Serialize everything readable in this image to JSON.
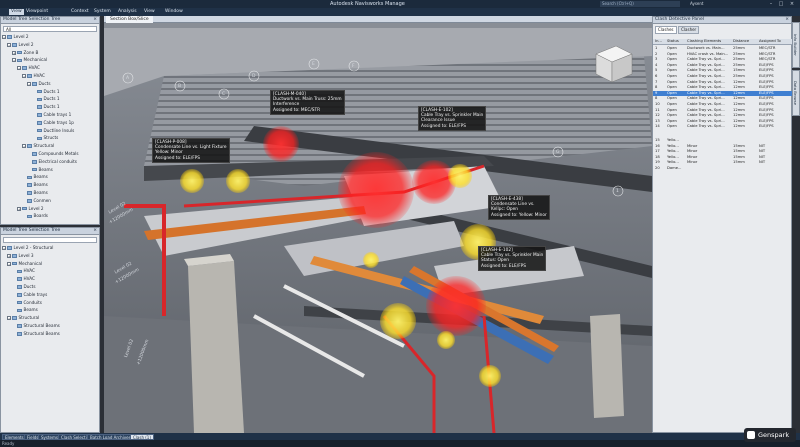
{
  "app": {
    "title": "Autodesk Navisworks Manage",
    "search_placeholder": "Search (Ctrl+Q)",
    "user": "Aysent",
    "window_controls": [
      "–",
      "□",
      "×"
    ]
  },
  "menu": [
    "View",
    "Viewpoint",
    "Context",
    "System",
    "Analysis",
    "View",
    "Window"
  ],
  "menu_active_index": 0,
  "left_top_panel": {
    "title": "Model Tree Selection Tree",
    "dropdown": "All",
    "items": [
      {
        "label": "Level 2",
        "depth": 0,
        "exp": "−"
      },
      {
        "label": "Level 2",
        "depth": 1,
        "exp": "−"
      },
      {
        "label": "Zone B",
        "depth": 2,
        "exp": "+"
      },
      {
        "label": "Mechanical",
        "depth": 2,
        "exp": "−"
      },
      {
        "label": "HVAC",
        "depth": 3,
        "exp": "−"
      },
      {
        "label": "HVAC",
        "depth": 4,
        "exp": "−"
      },
      {
        "label": "Ducts",
        "depth": 5,
        "exp": "−"
      },
      {
        "label": "Ducts 1",
        "depth": 6,
        "exp": ""
      },
      {
        "label": "Ducts 1",
        "depth": 6,
        "exp": ""
      },
      {
        "label": "Ducts 1",
        "depth": 6,
        "exp": ""
      },
      {
        "label": "Cable trays 1",
        "depth": 6,
        "exp": ""
      },
      {
        "label": "Cable trays 1p",
        "depth": 6,
        "exp": ""
      },
      {
        "label": "Ductline Insuls",
        "depth": 6,
        "exp": ""
      },
      {
        "label": "Structs",
        "depth": 6,
        "exp": ""
      },
      {
        "label": "Structural",
        "depth": 4,
        "exp": "−"
      },
      {
        "label": "Compounds Metals",
        "depth": 5,
        "exp": ""
      },
      {
        "label": "Electrical conduits",
        "depth": 5,
        "exp": ""
      },
      {
        "label": "Beams",
        "depth": 5,
        "exp": ""
      },
      {
        "label": "Beams",
        "depth": 4,
        "exp": ""
      },
      {
        "label": "Beams",
        "depth": 4,
        "exp": ""
      },
      {
        "label": "Beams",
        "depth": 4,
        "exp": ""
      },
      {
        "label": "Conmen",
        "depth": 4,
        "exp": ""
      },
      {
        "label": "Level 2",
        "depth": 3,
        "exp": "+"
      },
      {
        "label": "Boards",
        "depth": 4,
        "exp": ""
      }
    ]
  },
  "left_bottom_panel": {
    "title": "Model Tree Selection Tree",
    "dropdown": "",
    "items": [
      {
        "label": "Level 2 - Structural",
        "depth": 0,
        "exp": "−"
      },
      {
        "label": "Level 3",
        "depth": 1,
        "exp": "+"
      },
      {
        "label": "Mechanical",
        "depth": 1,
        "exp": "−"
      },
      {
        "label": "HVAC",
        "depth": 2,
        "exp": ""
      },
      {
        "label": "HVAC",
        "depth": 2,
        "exp": ""
      },
      {
        "label": "Ducts",
        "depth": 2,
        "exp": ""
      },
      {
        "label": "Cable trays",
        "depth": 2,
        "exp": ""
      },
      {
        "label": "Conduits",
        "depth": 2,
        "exp": ""
      },
      {
        "label": "Beams",
        "depth": 2,
        "exp": ""
      },
      {
        "label": "Structural",
        "depth": 1,
        "exp": "−"
      },
      {
        "label": "Structural Beams",
        "depth": 2,
        "exp": ""
      },
      {
        "label": "Structural Beams",
        "depth": 2,
        "exp": ""
      }
    ]
  },
  "viewport": {
    "tab_label": "Section Box/Slice",
    "levels": [
      "Level 02",
      "+12000mm",
      "Level 02",
      "+12000mm",
      "Level 02",
      "+12000mm"
    ],
    "grid_labels": [
      "A",
      "B",
      "C",
      "D",
      "E",
      "F",
      "G",
      "1"
    ],
    "callouts": [
      {
        "lines": [
          "[CLASH-M-040]",
          "Ductwork vs. Main Truss: 25mm",
          "Interference",
          "Assigned to: MEC/STR"
        ]
      },
      {
        "lines": [
          "[CLASH-E-102]",
          "Cable Tray vs. Sprinkler Main",
          "Clearance Issue",
          "Assigned to: ELE/FPS"
        ]
      },
      {
        "lines": [
          "[CLASH-P-008]",
          "Condensate Line vs. Light Fixture",
          "Yellow: Minor",
          "Assigned to: ELE/FPS"
        ]
      },
      {
        "lines": [
          "[CLASH-E-438]",
          "Condensate Line vs.",
          "Kellpc: Open",
          "Assigned to: Yellow: Minor"
        ]
      },
      {
        "lines": [
          "[CLASH-E-102]",
          "Cable Tray vs. Sprinkler Main",
          "Status: Open",
          "Assigned to: ELE/FPS"
        ]
      }
    ]
  },
  "clash_panel": {
    "title": "Clash Detective Panel",
    "tabs": [
      "Clashes",
      "Clasher"
    ],
    "columns": [
      "In...",
      "Status",
      "Clashing Elements",
      "Distance",
      "Assigned To"
    ],
    "selected_index": 8,
    "rows": [
      [
        "1",
        "Open",
        "Ductwork vs. Main...",
        "25mm",
        "MEC/STR"
      ],
      [
        "2",
        "Open",
        "HVAC crash vs. Main...",
        "25mm",
        "MEC/STR"
      ],
      [
        "3",
        "Open",
        "Cable Tray vs. Spri...",
        "25mm",
        "MEC/STR"
      ],
      [
        "4",
        "Open",
        "Cable Tray vs. Spri...",
        "25mm",
        "ELE/FPS"
      ],
      [
        "5",
        "Open",
        "Cable Tray vs. Spri...",
        "15mm",
        "ELE/FPS"
      ],
      [
        "6",
        "Open",
        "Cable Tray vs. Spri...",
        "25mm",
        "ELE/FPS"
      ],
      [
        "7",
        "Open",
        "Cable Tray vs. Spri...",
        "12mm",
        "ELE/FPS"
      ],
      [
        "8",
        "Open",
        "Cable Tray vs. Spri...",
        "12mm",
        "ELE/FPS"
      ],
      [
        "9",
        "Open",
        "Cable Tray vs. Spri...",
        "12mm",
        "ELE/FPS"
      ],
      [
        "8",
        "Open",
        "Cable Tray vs. Spri...",
        "12mm",
        "ELE/FPS"
      ],
      [
        "10",
        "Open",
        "Cable Tray vs. Spri...",
        "12mm",
        "ELE/FPS"
      ],
      [
        "11",
        "Open",
        "Cable Tray vs. Spri...",
        "12mm",
        "ELE/FPS"
      ],
      [
        "12",
        "Open",
        "Cable Tray vs. Spri...",
        "12mm",
        "ELE/FPS"
      ],
      [
        "13",
        "Open",
        "Cable Tray vs. Spri...",
        "12mm",
        "ELE/FPS"
      ],
      [
        "14",
        "Open",
        "Cable Tray vs. Spri...",
        "12mm",
        "ELE/FPS"
      ],
      [
        "15",
        "Yello...",
        "",
        "",
        ""
      ],
      [
        "16",
        "Yello...",
        "Minor",
        "15mm",
        "NIT"
      ],
      [
        "17",
        "Yello...",
        "Minor",
        "15mm",
        "NIT"
      ],
      [
        "18",
        "Yello...",
        "Minor",
        "15mm",
        "NIT"
      ],
      [
        "19",
        "Yello...",
        "Minor",
        "15mm",
        "NIT"
      ],
      [
        "20",
        "Dame...",
        "",
        "",
        ""
      ]
    ]
  },
  "side_tabs": [
    "Info Builder",
    "Data Browse"
  ],
  "bottom_tabs": [
    "Elements",
    "Fields",
    "Systems",
    "Clash Selection",
    "Batch Load Archives",
    "Clash (1)"
  ],
  "bottom_active_index": 5,
  "status": "Ready",
  "watermark": "Genspark",
  "colors": {
    "clash_red": "#ff2b2b",
    "clash_yellow": "#ffe02a",
    "selected_row": "#3f7fd1",
    "chrome_dark": "#1f3147"
  }
}
